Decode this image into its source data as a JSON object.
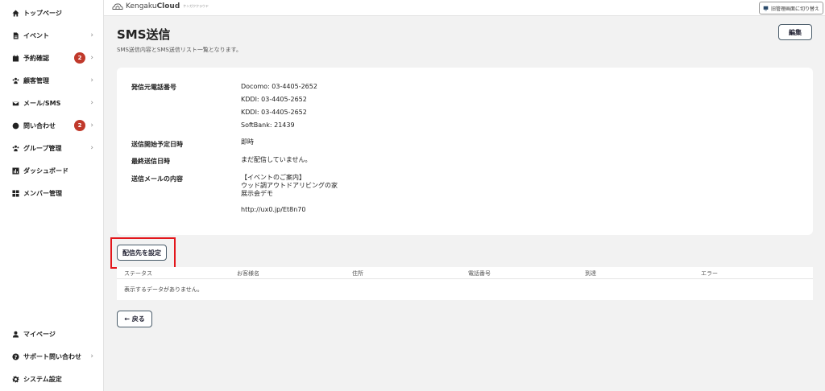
{
  "sidebar": {
    "items": [
      {
        "label": "トップページ",
        "icon": "home-icon",
        "chevron": false
      },
      {
        "label": "イベント",
        "icon": "document-icon",
        "chevron": true
      },
      {
        "label": "予約確認",
        "icon": "calendar-icon",
        "chevron": true,
        "badge": "2"
      },
      {
        "label": "顧客管理",
        "icon": "users-icon",
        "chevron": true
      },
      {
        "label": "メール/SMS",
        "icon": "mail-icon",
        "chevron": true
      },
      {
        "label": "問い合わせ",
        "icon": "chat-icon",
        "chevron": true,
        "badge": "2"
      },
      {
        "label": "グループ管理",
        "icon": "group-icon",
        "chevron": true
      },
      {
        "label": "ダッシュボード",
        "icon": "chart-icon",
        "chevron": false
      },
      {
        "label": "メンバー管理",
        "icon": "grid-icon",
        "chevron": false
      }
    ],
    "bottom_items": [
      {
        "label": "マイページ",
        "icon": "user-icon",
        "chevron": false
      },
      {
        "label": "サポート問い合わせ",
        "icon": "help-icon",
        "chevron": true
      },
      {
        "label": "システム設定",
        "icon": "gear-icon",
        "chevron": false
      }
    ],
    "chevron_glyph": "›",
    "badge_color": "#c0392b"
  },
  "header": {
    "brand_light": "Kengaku",
    "brand_bold": "Cloud",
    "brand_kana": "ケンガククラウド",
    "old_admin_label": "旧管理画面に切り替え"
  },
  "page": {
    "title": "SMS送信",
    "subtitle": "SMS送信内容とSMS送信リスト一覧となります。",
    "edit_label": "編集"
  },
  "details": {
    "sender_label": "発信元電話番号",
    "sender_values": [
      "Docomo: 03-4405-2652",
      "KDDI: 03-4405-2652",
      "KDDI: 03-4405-2652",
      "SoftBank: 21439"
    ],
    "schedule_label": "送信開始予定日時",
    "schedule_value": "即時",
    "last_sent_label": "最終送信日時",
    "last_sent_value": "まだ配信していません。",
    "content_label": "送信メールの内容",
    "content_lines": [
      "【イベントのご案内】",
      "ウッド調アウトドアリビングの家",
      "展示会デモ"
    ],
    "content_url": "http://ux0.jp/Et8n70"
  },
  "destination": {
    "button_label": "配信先を設定",
    "highlight_color": "#e3161b"
  },
  "table": {
    "columns": [
      "ステータス",
      "お客様名",
      "住所",
      "電話番号",
      "到達",
      "エラー"
    ],
    "empty_message": "表示するデータがありません。"
  },
  "back_label": "← 戻る"
}
